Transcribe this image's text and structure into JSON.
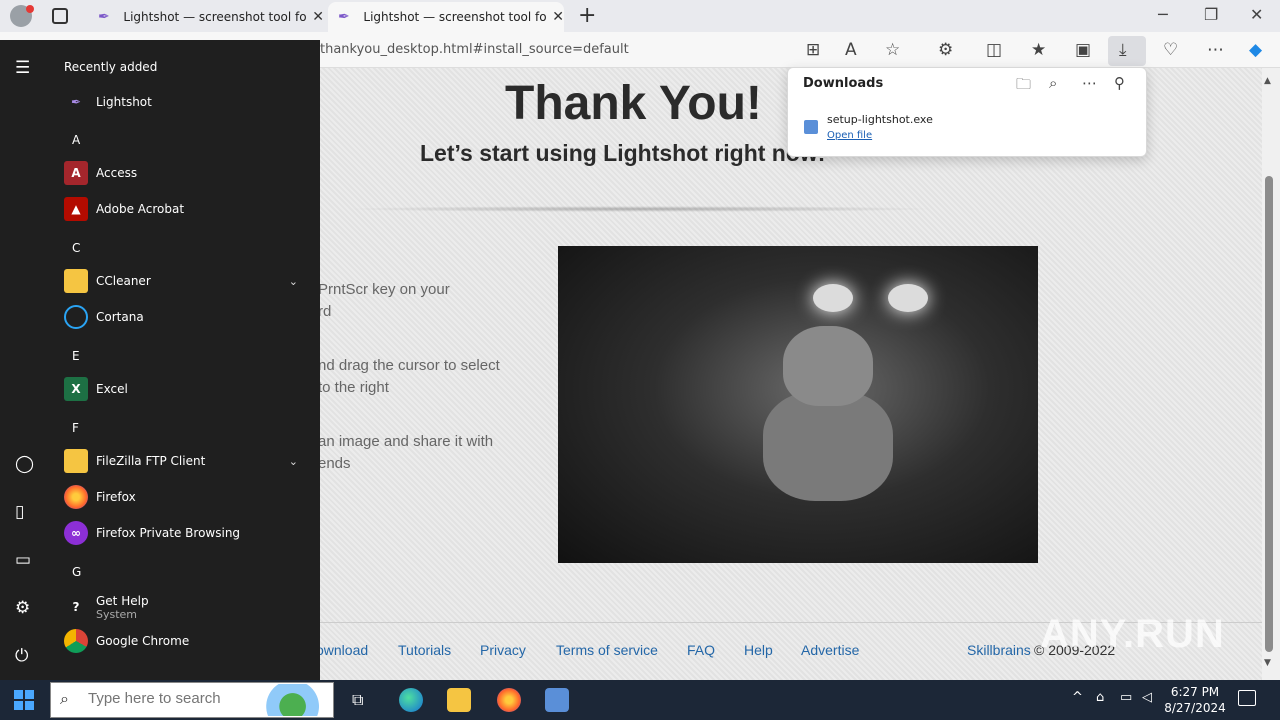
{
  "browser": {
    "tabs": [
      {
        "title": "Lightshot — screenshot tool for Mac & Win"
      },
      {
        "title": "Lightshot — screenshot tool for Mac & Win"
      }
    ],
    "address": "thankyou_desktop.html#install_source=default"
  },
  "page": {
    "heading": "Thank You!",
    "subheading": "Let’s start using Lightshot right now!",
    "steps": [
      {
        "line1": "PrntScr key on your",
        "line2": "rd"
      },
      {
        "line1": "nd drag the cursor to select",
        "line2": " to the right"
      },
      {
        "line1": "an image and share it with",
        "line2": "ends"
      }
    ],
    "footer_links": [
      "ownload",
      "Tutorials",
      "Privacy",
      "Terms of service",
      "FAQ",
      "Help",
      "Advertise"
    ],
    "brand_link": "Skillbrains",
    "copyright": "© 2009-2022",
    "watermark": "ANY.RUN"
  },
  "downloads": {
    "title": "Downloads",
    "file_name": "setup-lightshot.exe",
    "open_label": "Open file"
  },
  "start_menu": {
    "recent_header": "Recently added",
    "recent_app": "Lightshot",
    "letters": {
      "a": "A",
      "c": "C",
      "e": "E",
      "f": "F",
      "g": "G"
    },
    "apps": {
      "access": "Access",
      "acrobat": "Adobe Acrobat",
      "ccleaner": "CCleaner",
      "cortana": "Cortana",
      "excel": "Excel",
      "filezilla": "FileZilla FTP Client",
      "firefox": "Firefox",
      "firefox_private": "Firefox Private Browsing",
      "gethelp": "Get Help",
      "gethelp_sub": "System",
      "chrome": "Google Chrome"
    }
  },
  "taskbar": {
    "search_placeholder": "Type here to search",
    "time": "6:27 PM",
    "date": "8/27/2024"
  },
  "colors": {
    "accent": "#1a5fb4",
    "link": "#2467a8",
    "start_bg": "#1f1f1f",
    "taskbar_bg": "#1c2737"
  }
}
